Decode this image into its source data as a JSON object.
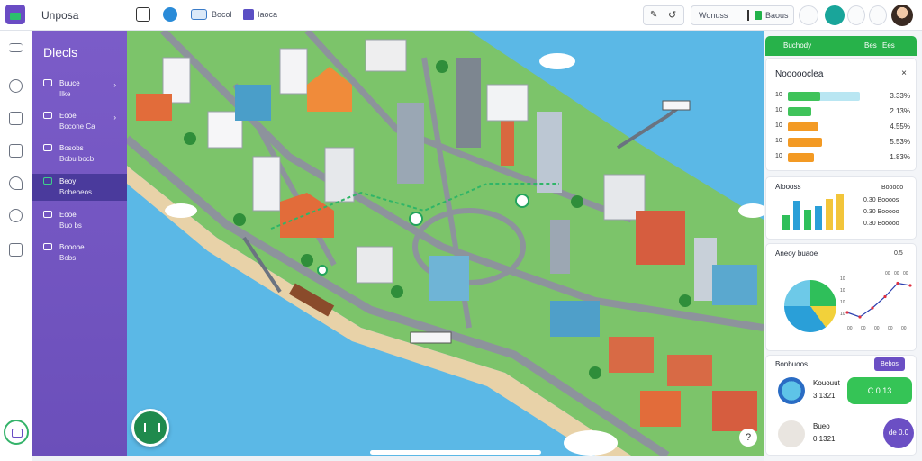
{
  "app": {
    "title": "Unposa"
  },
  "toolbar": {
    "grid_icon": "grid-icon",
    "bell_icon": "bell-icon",
    "tab1_label": "Bocol",
    "tab2_label": "Iaoca",
    "edit_icon": "pen-icon",
    "history_icon": "history-icon",
    "label_a": "Wonuss",
    "label_b": "Baous",
    "accent": "#22b24a"
  },
  "rail": {
    "items": [
      "menu-icon",
      "link-icon",
      "cube-icon",
      "home-icon",
      "tool-icon",
      "apple-icon",
      "document-icon"
    ]
  },
  "sidebar": {
    "title": "Dlecls",
    "items": [
      {
        "label": "Buuce",
        "sub": "Ilke",
        "chevron": "›"
      },
      {
        "label": "Eooe",
        "sub": "Bocone Ca",
        "chevron": "›"
      },
      {
        "label": "Bosobs",
        "sub": "Bobu bocb",
        "chevron": ""
      },
      {
        "label": "Beoy",
        "sub": "Bobebeos",
        "chevron": ""
      },
      {
        "label": "Eooe",
        "sub": "Buo bs",
        "chevron": ""
      },
      {
        "label": "Booobe",
        "sub": "Bobs",
        "chevron": ""
      }
    ],
    "active_index": 3
  },
  "panel": {
    "header": {
      "left": "Buchody",
      "right1": "Bes",
      "right2": "Ees"
    },
    "card1": {
      "title": "Noooooclea",
      "close": "×",
      "bars": [
        {
          "idx": "10",
          "value_label": "3.33%",
          "fill": 0.45,
          "color": "#3fc35a",
          "track": 1.0
        },
        {
          "idx": "10",
          "value_label": "2.13%",
          "fill": 0.33,
          "color": "#3fc35a",
          "track": 0.0
        },
        {
          "idx": "10",
          "value_label": "4.55%",
          "fill": 0.42,
          "color": "#f39a24",
          "track": 0.0
        },
        {
          "idx": "10",
          "value_label": "5.53%",
          "fill": 0.48,
          "color": "#f39a24",
          "track": 0.0
        },
        {
          "idx": "10",
          "value_label": "1.83%",
          "fill": 0.36,
          "color": "#f39a24",
          "track": 0.0
        }
      ]
    },
    "card2": {
      "title": "Aloooss",
      "side_labels": [
        "0.30 Boooos",
        "0.30 Booooo",
        "0.30 Booooo"
      ],
      "top_label": "Booooo",
      "mini_bars": [
        0.4,
        0.8,
        0.55,
        0.65,
        0.85,
        1.0
      ]
    },
    "card3": {
      "title": "Aneoy buaoe",
      "value": "0.5",
      "y_labels": [
        "10",
        "10",
        "10",
        "10"
      ],
      "x_labels": [
        "00",
        "00",
        "00",
        "00",
        "00"
      ],
      "right_labels": [
        "00",
        "00",
        "00"
      ],
      "line_points": [
        0.2,
        0.1,
        0.3,
        0.55,
        0.85,
        0.8
      ]
    },
    "card4": {
      "title": "Bonbuoos",
      "button": "Bebos",
      "person1": {
        "name": "Kououut",
        "number": "3.1321",
        "button": "C 0.13"
      },
      "person2": {
        "name": "Bueo",
        "number": "0.1321",
        "button": "de 0.0"
      }
    }
  },
  "map": {
    "help_label": "?"
  }
}
